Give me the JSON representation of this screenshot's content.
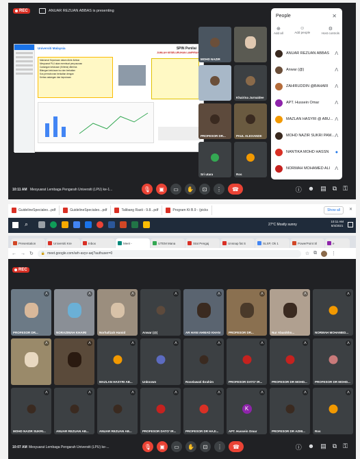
{
  "meet_top": {
    "rec_label": "REC",
    "presenting_text": "ANUAR REZUAN ABBAS is presenting",
    "time": "10:11 AM",
    "meeting_title": "Mesyuarat Lembaga Pengarah Universiti (LPU) ke-1...",
    "tiles": [
      {
        "name": "MOHD NAZIR"
      },
      {
        "name": ""
      },
      {
        "name": ""
      },
      {
        "name": "Khairina Jurnaidee"
      },
      {
        "name": "PROFESOR DR..."
      },
      {
        "name": "PAUL ALEXANDE"
      },
      {
        "name": "Sri utara"
      },
      {
        "name": "Ros"
      }
    ],
    "people": {
      "title": "People",
      "actions": [
        "Add all",
        "Add people",
        "Host controls"
      ],
      "list": [
        "ANUAR REZUAN ABBAS",
        "Anwar (@)",
        "ZAHIRUDDIN @BAHARI",
        "APT. Hussein Omar",
        "MAZLAN HASYRI @ ABU...",
        "MOHD NAZIR SUKRI PAM...",
        "NANTIKA MOHD HASSN",
        "NORMAH MOHAMED ALI"
      ]
    }
  },
  "slide": {
    "left_title": "Universiti Malaysia",
    "heading": "SPIN Penilai",
    "subheading": "JUMLAH KESELURUHAN LAMPIRAN",
    "bullets": [
      "Maklumat Keputusan dalam Akhir Akhbar",
      "Mesyuarat PLU akan membuat penyusunan",
      "Cadangan kelulusan (Kriteria) diterima",
      "Bilangan kelulusan isu dan berkaitan",
      "Kos permohonan berkaitan dengan",
      "Kertas cadangan dan keputusan"
    ]
  },
  "downloads": {
    "items": [
      "GuidelineSpecialeo...pdf",
      "GuidelineSpecialeo...pdf",
      "Talibang Rasti - 9.8...pdf",
      "Program Kt B.9 - (picks"
    ],
    "show_all": "Show all"
  },
  "taskbar": {
    "weather": "27°C Mostly sunny",
    "time": "10:11 AM",
    "date": "8/4/2021"
  },
  "browser": {
    "tabs": [
      "Presentation",
      "Universiti Kre",
      "Inbox",
      "Meet - ",
      "UTEM Mana",
      "Stat Pengaj",
      "Unsnap fat S",
      "SLSP, Ok 1",
      "PowerPoint Sl",
      "e"
    ],
    "url": "meet.google.com/arh-avyv-aej?authuser=0"
  },
  "meet_bottom": {
    "rec_label": "REC",
    "time": "10:07 AM",
    "meeting_title": "Mesyuarat Lembaga Pengarah Universiti (LPU) ke-...",
    "tiles": [
      {
        "name": "PROFESOR DR..."
      },
      {
        "name": "NORAZIMAH KHAIRI"
      },
      {
        "name": "Norhafizah Hamid"
      },
      {
        "name": "Anwar (@)"
      },
      {
        "name": "AR HANI AHMAD KHAN"
      },
      {
        "name": "PROFESOR DR..."
      },
      {
        "name": "Nur Abanikhn..."
      },
      {
        "name": "NORMAH MOHAMED..."
      },
      {
        "name": ""
      },
      {
        "name": ""
      },
      {
        "name": "MAZLAN HASYRI AB..."
      },
      {
        "name": "Unknown"
      },
      {
        "name": "Roselawati Ibrahim"
      },
      {
        "name": "PROFESOR DATO' IR..."
      },
      {
        "name": "PROFESOR DR MOHD..."
      },
      {
        "name": "PROFESOR DR MOHD..."
      },
      {
        "name": "MOHD NAZIR SUKRI..."
      },
      {
        "name": "ANUAR REZUAN AB..."
      },
      {
        "name": "ANUAR REZUAN AB..."
      },
      {
        "name": "PROFESOR DATO' IR..."
      },
      {
        "name": "PROFESOR DR HAJI..."
      },
      {
        "name": "APT. Hussein Omar"
      },
      {
        "name": "PROFESOR DR AZMI..."
      },
      {
        "name": "Ros"
      }
    ],
    "letter_avatar": "K"
  }
}
